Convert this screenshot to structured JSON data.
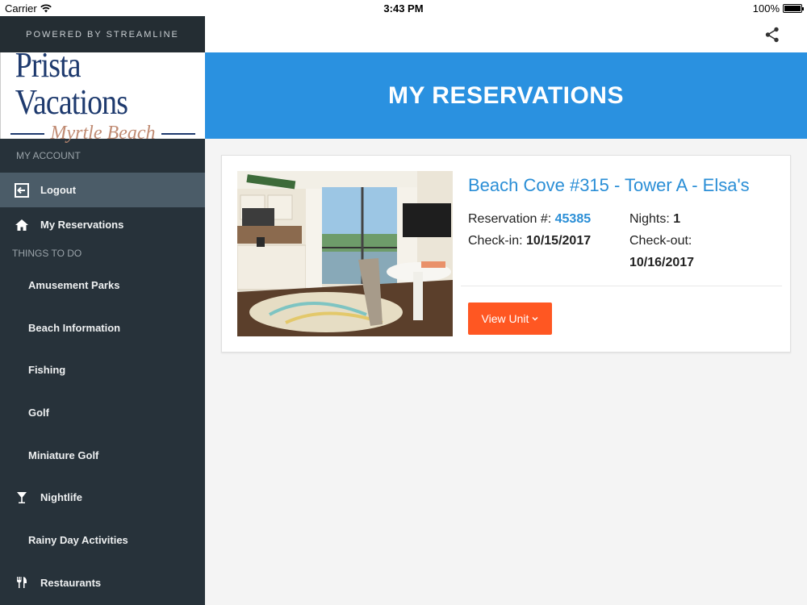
{
  "status_bar": {
    "carrier": "Carrier",
    "time": "3:43 PM",
    "battery": "100%"
  },
  "sidebar": {
    "powered_by": "POWERED BY STREAMLINE",
    "logo": {
      "main": "Prista Vacations",
      "sub": "Myrtle Beach"
    },
    "account_label": "MY ACCOUNT",
    "account_items": [
      {
        "label": "Logout",
        "icon": "logout-icon"
      },
      {
        "label": "My Reservations",
        "icon": "home-icon"
      }
    ],
    "things_label": "THINGS TO DO",
    "things_items": [
      {
        "label": "Amusement Parks"
      },
      {
        "label": "Beach Information"
      },
      {
        "label": "Fishing"
      },
      {
        "label": "Golf"
      },
      {
        "label": "Miniature Golf"
      },
      {
        "label": "Nightlife",
        "icon": "cocktail-icon"
      },
      {
        "label": "Rainy Day Activities"
      },
      {
        "label": "Restaurants",
        "icon": "utensils-icon"
      }
    ]
  },
  "header": {
    "share_icon": "share-icon"
  },
  "banner": {
    "title": "MY RESERVATIONS"
  },
  "reservation": {
    "unit_name": "Beach Cove #315 - Tower A - Elsa's",
    "reservation_label": "Reservation #:",
    "reservation_number": "45385",
    "checkin_label": "Check-in:",
    "checkin_date": "10/15/2017",
    "nights_label": "Nights:",
    "nights_value": "1",
    "checkout_label": "Check-out:",
    "checkout_date": "10/16/2017",
    "view_button": "View Unit"
  },
  "colors": {
    "accent_blue": "#2a91e0",
    "button_orange": "#ff5722",
    "sidebar_bg": "#27323a",
    "sidebar_active": "#4b5c68"
  }
}
